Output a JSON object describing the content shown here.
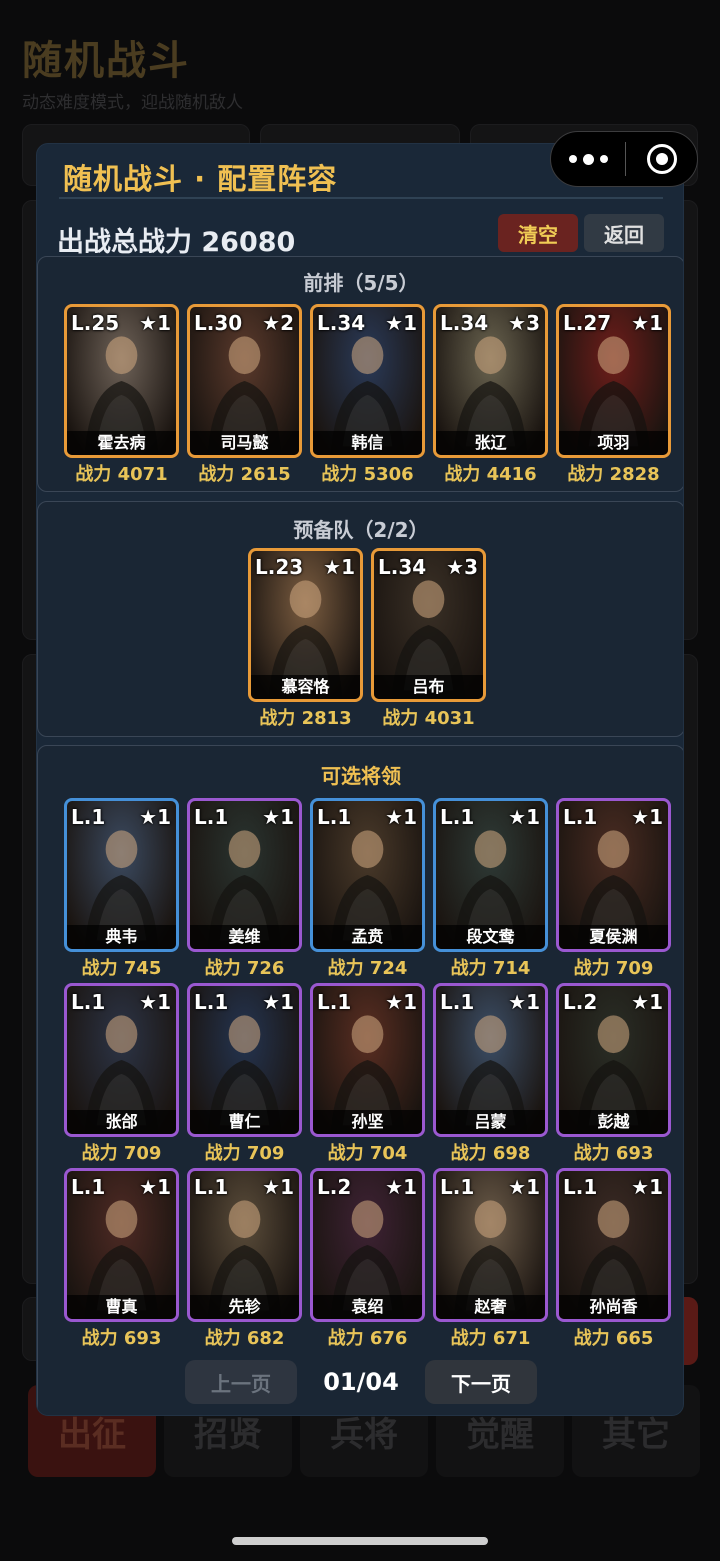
{
  "background": {
    "title": "随机战斗",
    "subtitle": "动态难度模式，迎战随机敌人",
    "tabs": [
      "出征",
      "招贤",
      "兵将",
      "觉醒",
      "其它"
    ],
    "active_tab": 0
  },
  "modal": {
    "title": "随机战斗 · 配置阵容",
    "total_power_label": "出战总战力 26080",
    "clear_label": "清空",
    "back_label": "返回"
  },
  "front": {
    "title": "前排（5/5）",
    "cards": [
      {
        "level": "L.25",
        "star": "★1",
        "name": "霍去病",
        "power": "战力 4071",
        "rarity": "orange",
        "tone": "#6e6258"
      },
      {
        "level": "L.30",
        "star": "★2",
        "name": "司马懿",
        "power": "战力 2615",
        "rarity": "orange",
        "tone": "#5b3a2c"
      },
      {
        "level": "L.34",
        "star": "★1",
        "name": "韩信",
        "power": "战力 5306",
        "rarity": "orange",
        "tone": "#2a3a58"
      },
      {
        "level": "L.34",
        "star": "★3",
        "name": "张辽",
        "power": "战力 4416",
        "rarity": "orange",
        "tone": "#6a6450"
      },
      {
        "level": "L.27",
        "star": "★1",
        "name": "项羽",
        "power": "战力 2828",
        "rarity": "orange",
        "tone": "#6e1d1a"
      }
    ]
  },
  "reserve": {
    "title": "预备队（2/2）",
    "cards": [
      {
        "level": "L.23",
        "star": "★1",
        "name": "慕容恪",
        "power": "战力 2813",
        "rarity": "orange",
        "tone": "#7a5c40"
      },
      {
        "level": "L.34",
        "star": "★3",
        "name": "吕布",
        "power": "战力 4031",
        "rarity": "orange",
        "tone": "#3a3026"
      }
    ]
  },
  "available": {
    "title": "可选将领",
    "rows": [
      [
        {
          "level": "L.1",
          "star": "★1",
          "name": "典韦",
          "power": "战力 745",
          "rarity": "blue",
          "tone": "#3b4a60"
        },
        {
          "level": "L.1",
          "star": "★1",
          "name": "姜维",
          "power": "战力 726",
          "rarity": "purple",
          "tone": "#2a3430"
        },
        {
          "level": "L.1",
          "star": "★1",
          "name": "孟贲",
          "power": "战力 724",
          "rarity": "blue",
          "tone": "#4a3a2a"
        },
        {
          "level": "L.1",
          "star": "★1",
          "name": "段文鸯",
          "power": "战力 714",
          "rarity": "blue",
          "tone": "#2e3a36"
        },
        {
          "level": "L.1",
          "star": "★1",
          "name": "夏侯渊",
          "power": "战力 709",
          "rarity": "purple",
          "tone": "#4a2c22"
        }
      ],
      [
        {
          "level": "L.1",
          "star": "★1",
          "name": "张郃",
          "power": "战力 709",
          "rarity": "purple",
          "tone": "#2c3446"
        },
        {
          "level": "L.1",
          "star": "★1",
          "name": "曹仁",
          "power": "战力 709",
          "rarity": "purple",
          "tone": "#243450"
        },
        {
          "level": "L.1",
          "star": "★1",
          "name": "孙坚",
          "power": "战力 704",
          "rarity": "purple",
          "tone": "#5a2e22"
        },
        {
          "level": "L.1",
          "star": "★1",
          "name": "吕蒙",
          "power": "战力 698",
          "rarity": "purple",
          "tone": "#3c4e66"
        },
        {
          "level": "L.2",
          "star": "★1",
          "name": "彭越",
          "power": "战力 693",
          "rarity": "purple",
          "tone": "#2a2e26"
        }
      ],
      [
        {
          "level": "L.1",
          "star": "★1",
          "name": "曹真",
          "power": "战力 693",
          "rarity": "purple",
          "tone": "#4e2a24"
        },
        {
          "level": "L.1",
          "star": "★1",
          "name": "先轸",
          "power": "战力 682",
          "rarity": "purple",
          "tone": "#5a4c3a"
        },
        {
          "level": "L.2",
          "star": "★1",
          "name": "袁绍",
          "power": "战力 676",
          "rarity": "purple",
          "tone": "#3e2234"
        },
        {
          "level": "L.1",
          "star": "★1",
          "name": "赵奢",
          "power": "战力 671",
          "rarity": "purple",
          "tone": "#6a5a48"
        },
        {
          "level": "L.1",
          "star": "★1",
          "name": "孙尚香",
          "power": "战力 665",
          "rarity": "purple",
          "tone": "#3a2a24"
        }
      ]
    ]
  },
  "pager": {
    "prev_label": "上一页",
    "page": "01/04",
    "next_label": "下一页"
  }
}
